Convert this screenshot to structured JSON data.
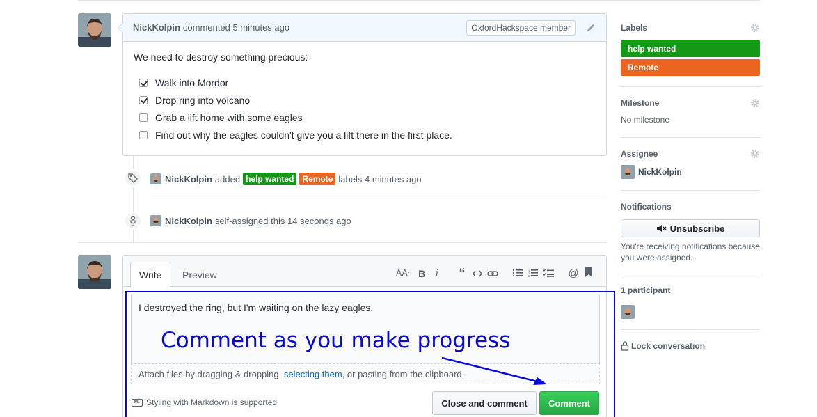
{
  "comment": {
    "author": "NickKolpin",
    "meta": "commented 5 minutes ago",
    "badge": "OxfordHackspace member",
    "intro": "We need to destroy something precious:",
    "tasks": [
      {
        "text": "Walk into Mordor",
        "checked": true
      },
      {
        "text": "Drop ring into volcano",
        "checked": true
      },
      {
        "text": "Grab a lift home with some eagles",
        "checked": false
      },
      {
        "text": "Find out why the eagles couldn't give you a lift there in the first place.",
        "checked": false
      }
    ]
  },
  "events": [
    {
      "user": "NickKolpin",
      "before": "added",
      "labels": [
        {
          "name": "help wanted",
          "color": "#159818"
        },
        {
          "name": "Remote",
          "color": "#eb6420"
        }
      ],
      "after": "labels 4 minutes ago",
      "icon": "tag-icon"
    },
    {
      "user": "NickKolpin",
      "text": "self-assigned this 14 seconds ago",
      "icon": "person-icon"
    }
  ],
  "form": {
    "tab_write": "Write",
    "tab_preview": "Preview",
    "text": "I destroyed the ring, but I'm waiting on the lazy eagles.",
    "attach_before": "Attach files by dragging & dropping, ",
    "attach_link": "selecting them",
    "attach_after": ", or pasting from the clipboard.",
    "markdown_note": "Styling with Markdown is supported",
    "close_button": "Close and comment",
    "comment_button": "Comment"
  },
  "annotation": {
    "text": "Comment as you make progress",
    "color": "#0a08d6"
  },
  "sidebar": {
    "labels_title": "Labels",
    "labels": [
      {
        "name": "help wanted",
        "color": "#159818"
      },
      {
        "name": "Remote",
        "color": "#eb6420"
      }
    ],
    "milestone_title": "Milestone",
    "milestone_value": "No milestone",
    "assignee_title": "Assignee",
    "assignee": "NickKolpin",
    "notifications_title": "Notifications",
    "unsubscribe": "Unsubscribe",
    "notif_text": "You're receiving notifications because you were assigned.",
    "participants_title": "1 participant",
    "lock": "Lock conversation"
  }
}
